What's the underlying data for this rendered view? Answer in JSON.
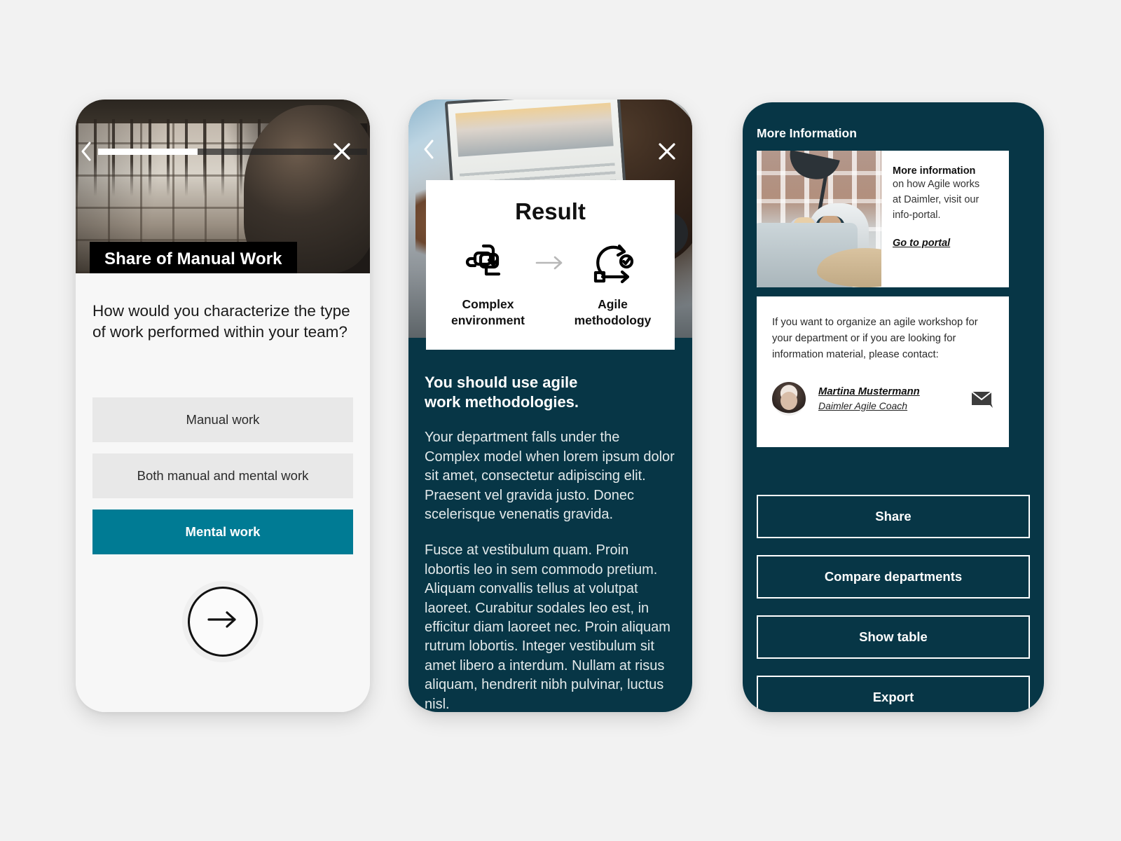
{
  "colors": {
    "page_background": "#f2f2f2",
    "navy": "#073646",
    "teal_accent": "#007b94",
    "option_gray": "#e8e8e8",
    "white": "#ffffff",
    "black": "#000000"
  },
  "screen1": {
    "nav": {
      "back_icon": "chevron-left-icon",
      "close_icon": "close-icon",
      "progress_percent": 37
    },
    "title": "Share of Manual Work",
    "question": "How would you characterize the type of work performed within your team?",
    "options": [
      {
        "label": "Manual work",
        "selected": false
      },
      {
        "label": "Both manual and mental work",
        "selected": false
      },
      {
        "label": "Mental work",
        "selected": true
      }
    ],
    "next_icon": "arrow-right-icon",
    "hero_image_alt": "workshop-photo"
  },
  "screen2": {
    "nav": {
      "back_icon": "chevron-left-icon",
      "close_icon": "close-icon"
    },
    "hero_image_alt": "laptop-desk-photo",
    "result_card": {
      "title": "Result",
      "left": {
        "icon": "complex-environment-icon",
        "label": "Complex\nenvironment",
        "label_line1": "Complex",
        "label_line2": "environment"
      },
      "arrow_icon": "arrow-right-icon",
      "right": {
        "icon": "agile-methodology-icon",
        "label_line1": "Agile",
        "label_line2": "methodology"
      }
    },
    "headline_line1": "You should use agile",
    "headline_line2": "work methodologies.",
    "paragraph1": "Your department falls under the Complex model when lorem ipsum dolor sit amet, consectetur adipiscing elit. Praesent vel gravida justo. Donec scelerisque venenatis gravida.",
    "paragraph2": "Fusce at vestibulum quam. Proin lobortis leo in sem commodo pretium. Aliquam convallis tellus at volutpat laoreet. Curabitur sodales leo est, in efficitur diam laoreet nec. Proin aliquam rutrum lobortis. Integer vestibulum sit amet libero a interdum. Nullam at risus aliquam, hendrerit nibh pulvinar, luctus nisl."
  },
  "screen3": {
    "title": "More Information",
    "info_card": {
      "image_alt": "lounge-meeting-photo",
      "heading": "More information",
      "line1": "on how Agile works",
      "line2": "at Daimler, visit our",
      "line3": "info-portal.",
      "link": "Go to portal"
    },
    "contact_card": {
      "text": "If you want to organize an agile workshop for your department or if you are looking for information material, please contact:",
      "person_name": "Martina Mustermann",
      "person_role": "Daimler Agile Coach",
      "avatar_alt": "martina-mustermann-avatar",
      "mail_icon": "envelope-edit-icon"
    },
    "buttons": [
      {
        "label": "Share"
      },
      {
        "label": "Compare departments"
      },
      {
        "label": "Show table"
      },
      {
        "label": "Export"
      }
    ]
  }
}
